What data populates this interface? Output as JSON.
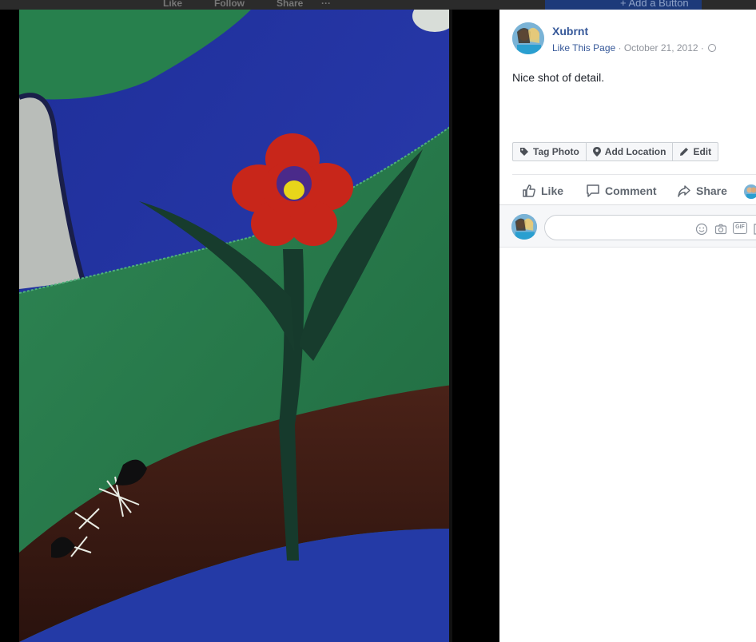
{
  "background_chrome": {
    "items": [
      "Like",
      "Follow",
      "Share",
      "···"
    ],
    "add_button": "+ Add a Button"
  },
  "post": {
    "page_name": "Xubrnt",
    "like_page": "Like This Page",
    "separator": " · ",
    "date": "October 21, 2012",
    "privacy_icon": "globe-icon",
    "caption": "Nice shot of detail."
  },
  "photo_tools": [
    {
      "label": "Tag Photo",
      "icon": "tag-icon"
    },
    {
      "label": "Add Location",
      "icon": "location-pin-icon"
    },
    {
      "label": "Edit",
      "icon": "pencil-icon"
    }
  ],
  "actions": [
    {
      "label": "Like",
      "icon": "thumbs-up-icon"
    },
    {
      "label": "Comment",
      "icon": "comment-bubble-icon"
    },
    {
      "label": "Share",
      "icon": "share-arrow-icon"
    }
  ],
  "comment_box": {
    "placeholder": "",
    "icons": [
      "emoji-icon",
      "camera-icon",
      "gif-icon",
      "sticker-icon"
    ],
    "gif_label": "GIF"
  },
  "colors": {
    "link": "#365899",
    "meta": "#90949c",
    "fabric_blue": "#2a3aa8",
    "fabric_green": "#2c7a4e",
    "flower_red": "#c8261a",
    "flower_center": "#e8d51a",
    "branch_brown": "#3a1c14"
  }
}
